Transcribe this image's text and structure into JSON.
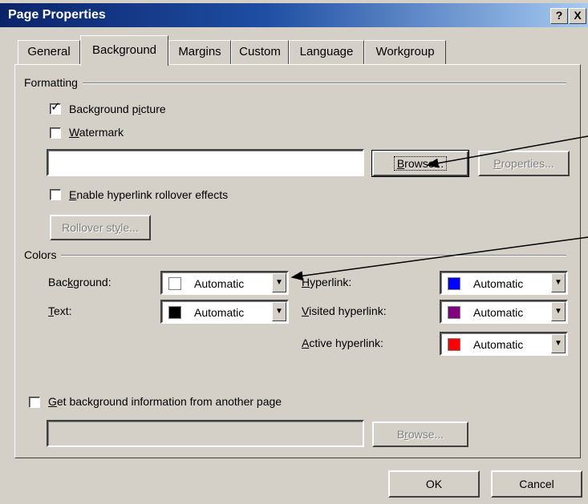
{
  "window": {
    "title": "Page Properties",
    "help_label": "?",
    "close_label": "X"
  },
  "tabs": [
    {
      "label": "General",
      "active": false
    },
    {
      "label": "Background",
      "active": true
    },
    {
      "label": "Margins",
      "active": false
    },
    {
      "label": "Custom",
      "active": false
    },
    {
      "label": "Language",
      "active": false
    },
    {
      "label": "Workgroup",
      "active": false
    }
  ],
  "formatting": {
    "group_label": "Formatting",
    "background_picture": {
      "label_pre": "Background p",
      "label_key": "i",
      "label_post": "cture",
      "checked": true
    },
    "watermark": {
      "label_key": "W",
      "label_post": "atermark",
      "checked": false
    },
    "picture_path": "",
    "browse_label_key": "B",
    "browse_label_post": "rowse...",
    "properties_label_key": "P",
    "properties_label_post": "roperties...",
    "rollover_effects": {
      "label_key": "E",
      "label_post": "nable hyperlink rollover effects",
      "checked": false
    },
    "rollover_style_label_pre": "Rollover st",
    "rollover_style_label_key": "y",
    "rollover_style_label_post": "le..."
  },
  "colors": {
    "group_label": "Colors",
    "background": {
      "label_pre": "Bac",
      "label_key": "k",
      "label_post": "ground:",
      "value": "Automatic",
      "swatch": "#ffffff"
    },
    "text": {
      "label_key": "T",
      "label_post": "ext:",
      "value": "Automatic",
      "swatch": "#000000"
    },
    "hyperlink": {
      "label_key": "H",
      "label_post": "yperlink:",
      "value": "Automatic",
      "swatch": "#0000ff"
    },
    "visited": {
      "label_key": "V",
      "label_post": "isited hyperlink:",
      "value": "Automatic",
      "swatch": "#800080"
    },
    "active": {
      "label_key": "A",
      "label_post": "ctive hyperlink:",
      "value": "Automatic",
      "swatch": "#ff0000"
    }
  },
  "other_page": {
    "label_key": "G",
    "label_post": "et background information from another page",
    "checked": false,
    "path": "",
    "browse_label_pre": "B",
    "browse_label_key": "r",
    "browse_label_post": "owse..."
  },
  "footer": {
    "ok_label": "OK",
    "cancel_label": "Cancel"
  }
}
